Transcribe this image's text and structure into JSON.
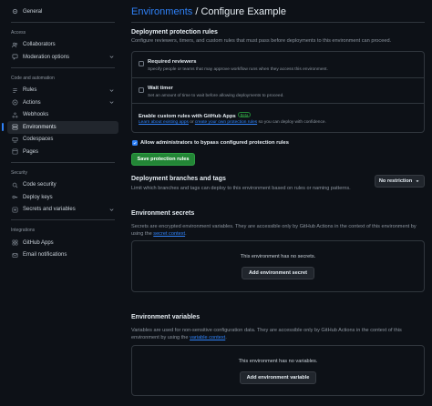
{
  "sidebar": {
    "general": "General",
    "section_access": "Access",
    "collaborators": "Collaborators",
    "moderation": "Moderation options",
    "section_code": "Code and automation",
    "rules": "Rules",
    "actions": "Actions",
    "webhooks": "Webhooks",
    "environments": "Environments",
    "codespaces": "Codespaces",
    "pages": "Pages",
    "section_security": "Security",
    "code_security": "Code security",
    "deploy_keys": "Deploy keys",
    "secrets_vars": "Secrets and variables",
    "section_integrations": "Integrations",
    "github_apps": "GitHub Apps",
    "email_notifications": "Email notifications"
  },
  "header": {
    "crumb": "Environments",
    "separator": " / ",
    "title": "Configure Example"
  },
  "protection": {
    "heading": "Deployment protection rules",
    "description": "Configure reviewers, timers, and custom rules that must pass before deployments to this environment can proceed.",
    "required_reviewers": {
      "label": "Required reviewers",
      "sub": "Specify people or teams that may approve workflow runs when they access this environment."
    },
    "wait_timer": {
      "label": "Wait timer",
      "sub": "Set an amount of time to wait before allowing deployments to proceed."
    },
    "custom": {
      "label": "Enable custom rules with GitHub Apps",
      "badge": "Beta",
      "link1": "Learn about existing apps",
      "mid": " or ",
      "link2": "create your own protection rules",
      "tail": " so you can deploy with confidence."
    },
    "admin_bypass": "Allow administrators to bypass configured protection rules",
    "save_button": "Save protection rules"
  },
  "branches": {
    "heading": "Deployment branches and tags",
    "description": "Limit which branches and tags can deploy to this environment based on rules or naming patterns.",
    "dropdown": "No restriction"
  },
  "secrets": {
    "heading": "Environment secrets",
    "desc_a": "Secrets are encrypted environment variables. They are accessible only by GitHub Actions in the context of this",
    "desc_b": "environment by using the ",
    "link": "secret context",
    "desc_end": ".",
    "empty": "This environment has no secrets.",
    "button": "Add environment secret"
  },
  "variables": {
    "heading": "Environment variables",
    "desc_a": "Variables are used for non-sensitive configuration data. They are accessible only by GitHub Actions in the context",
    "desc_b": "of this environment by using the ",
    "link": "variable context",
    "desc_end": ".",
    "empty": "This environment has no variables.",
    "button": "Add environment variable"
  },
  "colors": {
    "background": "#0d1117",
    "accent": "#2f81f7",
    "primary_button": "#238636",
    "border": "#30363d"
  }
}
